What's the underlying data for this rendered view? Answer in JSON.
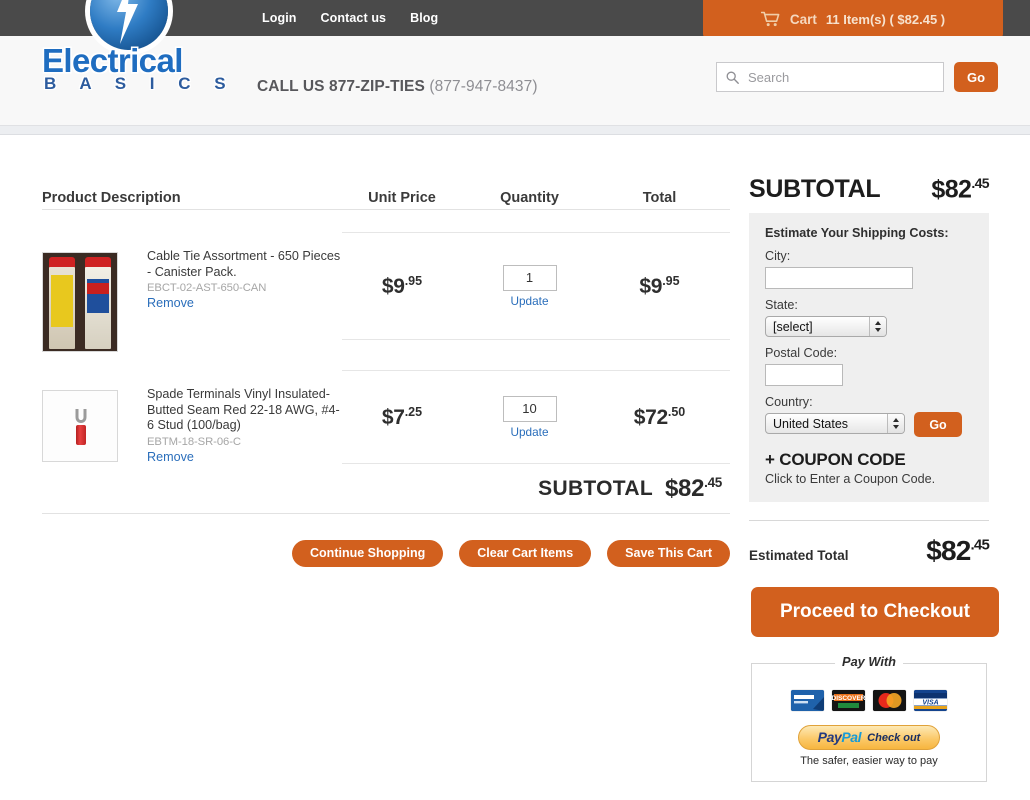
{
  "topbar": {
    "nav": [
      {
        "label": "Login"
      },
      {
        "label": "Contact us"
      },
      {
        "label": "Blog"
      }
    ],
    "cart": {
      "icon": "shopping-cart-icon",
      "label": "Cart",
      "summary": "11 Item(s) ( $82.45 )"
    }
  },
  "header": {
    "logo": {
      "word": "Electrical",
      "sub": "B A S I C S",
      "mark": "lightning-bolt-orb-icon"
    },
    "call_us": "CALL US 877-ZIP-TIES",
    "phone": "(877-947-8437)",
    "search": {
      "icon": "search-icon",
      "placeholder": "Search",
      "value": "",
      "go_label": "Go"
    }
  },
  "cart_table": {
    "columns": [
      "Product Description",
      "Unit Price",
      "Quantity",
      "Total"
    ],
    "rows": [
      {
        "image": "cable-tie-canister-photo",
        "name": "Cable Tie Assortment - 650 Pieces - Canister Pack.",
        "sku": "EBCT-02-AST-650-CAN",
        "remove_label": "Remove",
        "unit_price_dollars": "$9",
        "unit_price_cents": ".95",
        "quantity": "1",
        "update_label": "Update",
        "total_dollars": "$9",
        "total_cents": ".95"
      },
      {
        "image": "red-spade-terminal-photo",
        "name": "Spade Terminals Vinyl Insulated-Butted Seam Red 22-18 AWG, #4-6 Stud (100/bag)",
        "sku": "EBTM-18-SR-06-C",
        "remove_label": "Remove",
        "unit_price_dollars": "$7",
        "unit_price_cents": ".25",
        "quantity": "10",
        "update_label": "Update",
        "total_dollars": "$72",
        "total_cents": ".50"
      }
    ],
    "subtotal_label": "SUBTOTAL",
    "subtotal_dollars": "$82",
    "subtotal_cents": ".45"
  },
  "actions": {
    "continue_shopping": "Continue Shopping",
    "clear_cart": "Clear Cart Items",
    "save_cart": "Save This Cart"
  },
  "sidebar": {
    "subtotal_label": "SUBTOTAL",
    "subtotal_dollars": "$82",
    "subtotal_cents": ".45",
    "shipping": {
      "title": "Estimate Your Shipping Costs:",
      "city_label": "City:",
      "city_value": "",
      "state_label": "State:",
      "state_value": "[select]",
      "postal_label": "Postal Code:",
      "postal_value": "",
      "country_label": "Country:",
      "country_value": "United States",
      "go_label": "Go"
    },
    "coupon": {
      "title": "+ COUPON CODE",
      "subtitle": "Click to Enter a Coupon Code."
    },
    "estimated_total_label": "Estimated Total",
    "estimated_total_dollars": "$82",
    "estimated_total_cents": ".45",
    "checkout_label": "Proceed to Checkout",
    "pay_with": {
      "title": "Pay With",
      "cards": [
        "american-express-card-icon",
        "discover-card-icon",
        "mastercard-card-icon",
        "visa-card-icon"
      ],
      "paypal_pay": "Pay",
      "paypal_pal": "Pal",
      "paypal_checkout": "Check out",
      "tagline": "The safer, easier way to pay"
    }
  },
  "colors": {
    "accent_orange": "#d2601e",
    "topbar_dark": "#4a4a4a",
    "link_blue": "#2a6ebb",
    "logo_blue": "#1f6dc0",
    "panel_gray": "#efefef"
  }
}
